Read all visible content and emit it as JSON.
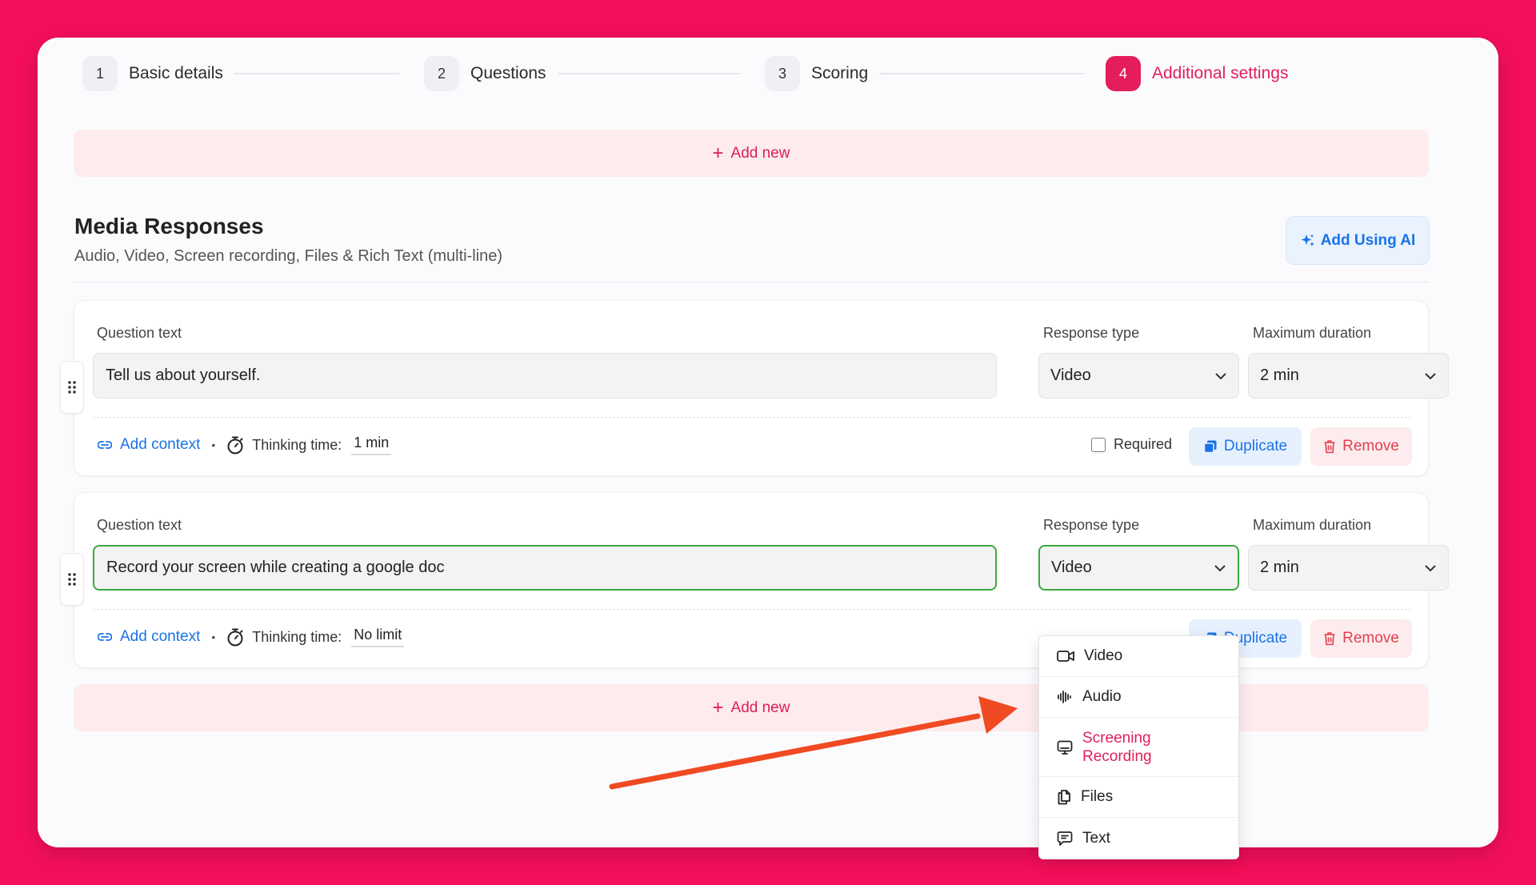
{
  "stepper": [
    {
      "num": "1",
      "label": "Basic details",
      "active": false
    },
    {
      "num": "2",
      "label": "Questions",
      "active": false
    },
    {
      "num": "3",
      "label": "Scoring",
      "active": false
    },
    {
      "num": "4",
      "label": "Additional settings",
      "active": true
    }
  ],
  "add_new": {
    "label": "Add new"
  },
  "section": {
    "title": "Media Responses",
    "subtitle": "Audio, Video, Screen recording, Files & Rich Text (multi-line)",
    "ai_button": "Add Using AI"
  },
  "questions": [
    {
      "question_label": "Question text",
      "question_value": "Tell us about yourself.",
      "response_type_label": "Response type",
      "response_type_value": "Video",
      "max_duration_label": "Maximum duration",
      "max_duration_value": "2 min",
      "add_context": "Add context",
      "thinking_label": "Thinking time:",
      "thinking_value": "1 min",
      "required_label": "Required",
      "duplicate": "Duplicate",
      "remove": "Remove"
    },
    {
      "question_label": "Question text",
      "question_value": "Record your screen while creating a google doc",
      "response_type_label": "Response type",
      "response_type_value": "Video",
      "max_duration_label": "Maximum duration",
      "max_duration_value": "2 min",
      "add_context": "Add context",
      "thinking_label": "Thinking time:",
      "thinking_value": "No limit",
      "duplicate": "Duplicate",
      "remove": "Remove"
    }
  ],
  "response_type_menu": [
    {
      "label": "Video",
      "icon": "video-icon",
      "selected": false
    },
    {
      "label": "Audio",
      "icon": "audio-icon",
      "selected": false
    },
    {
      "label": "Screening Recording",
      "label_line1": "Screening",
      "label_line2": "Recording",
      "icon": "screen-icon",
      "selected": true
    },
    {
      "label": "Files",
      "icon": "files-icon",
      "selected": false
    },
    {
      "label": "Text",
      "icon": "text-icon",
      "selected": false
    }
  ],
  "colors": {
    "background": "#f50f5a",
    "accent": "#e51d5c",
    "link_blue": "#1a73e8",
    "focus_green": "#3ea83e",
    "arrow": "#f04a23"
  }
}
